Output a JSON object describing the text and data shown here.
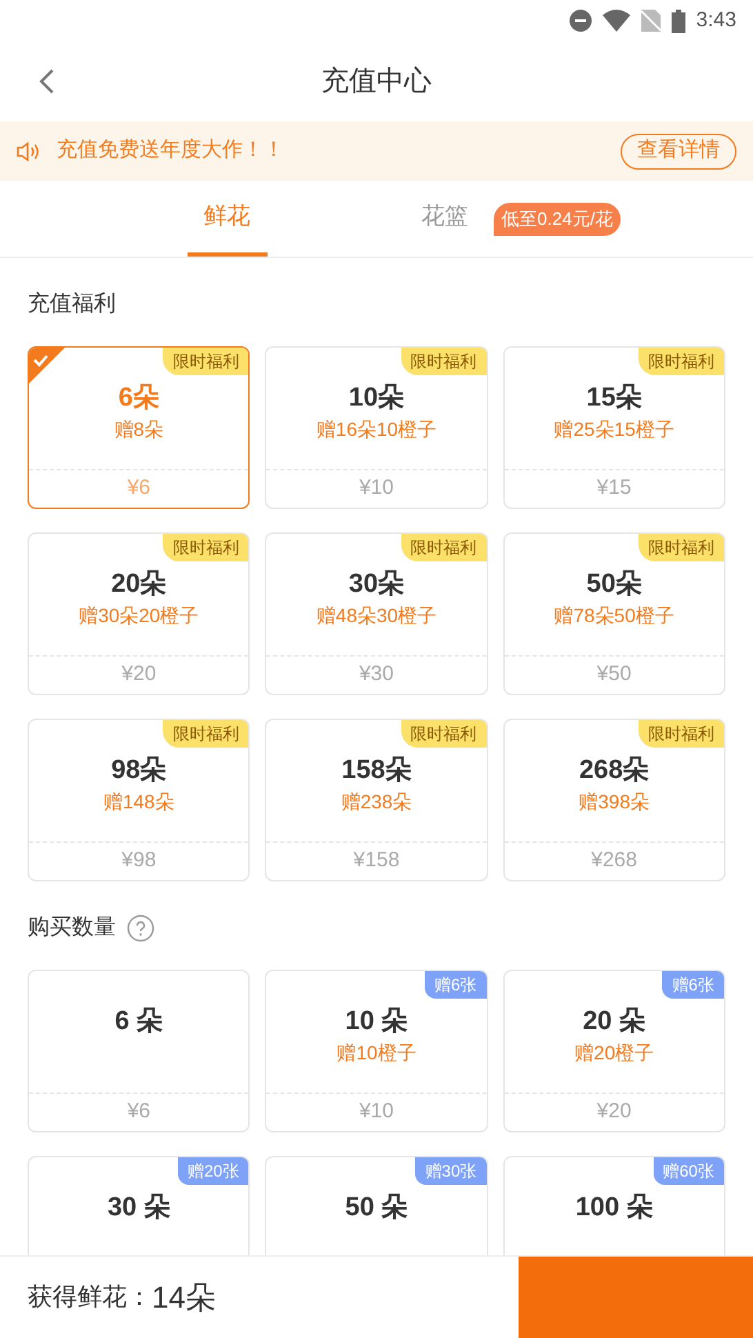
{
  "status_bar": {
    "time": "3:43"
  },
  "header": {
    "title": "充值中心"
  },
  "notice": {
    "text": "充值免费送年度大作！！",
    "button": "查看详情"
  },
  "tabs": [
    {
      "label": "鲜花",
      "selected": true
    },
    {
      "label": "花篮",
      "selected": false,
      "badge": "低至0.24元/花"
    }
  ],
  "sections": [
    {
      "kind": "welfare",
      "title": "充值福利",
      "help": false,
      "cards": [
        {
          "title": "6朵",
          "gift": "赠8朵",
          "price": "¥6",
          "badge": "限时福利",
          "selected": true
        },
        {
          "title": "10朵",
          "gift": "赠16朵10橙子",
          "price": "¥10",
          "badge": "限时福利",
          "selected": false
        },
        {
          "title": "15朵",
          "gift": "赠25朵15橙子",
          "price": "¥15",
          "badge": "限时福利",
          "selected": false
        },
        {
          "title": "20朵",
          "gift": "赠30朵20橙子",
          "price": "¥20",
          "badge": "限时福利",
          "selected": false
        },
        {
          "title": "30朵",
          "gift": "赠48朵30橙子",
          "price": "¥30",
          "badge": "限时福利",
          "selected": false
        },
        {
          "title": "50朵",
          "gift": "赠78朵50橙子",
          "price": "¥50",
          "badge": "限时福利",
          "selected": false
        },
        {
          "title": "98朵",
          "gift": "赠148朵",
          "price": "¥98",
          "badge": "限时福利",
          "selected": false
        },
        {
          "title": "158朵",
          "gift": "赠238朵",
          "price": "¥158",
          "badge": "限时福利",
          "selected": false
        },
        {
          "title": "268朵",
          "gift": "赠398朵",
          "price": "¥268",
          "badge": "限时福利",
          "selected": false
        }
      ]
    },
    {
      "kind": "quantity",
      "title": "购买数量",
      "help": true,
      "cards": [
        {
          "title": "6 朵",
          "price": "¥6",
          "selected": false
        },
        {
          "title": "10 朵",
          "gift": "赠10橙子",
          "price": "¥10",
          "badge": "赠6张",
          "selected": false
        },
        {
          "title": "20 朵",
          "gift": "赠20橙子",
          "price": "¥20",
          "badge": "赠6张",
          "selected": false
        },
        {
          "title": "30 朵",
          "badge": "赠20张",
          "selected": false
        },
        {
          "title": "50 朵",
          "badge": "赠30张",
          "selected": false
        },
        {
          "title": "100 朵",
          "badge": "赠60张",
          "selected": false
        }
      ]
    }
  ],
  "footer": {
    "label": "获得鲜花：",
    "value": "14朵"
  }
}
